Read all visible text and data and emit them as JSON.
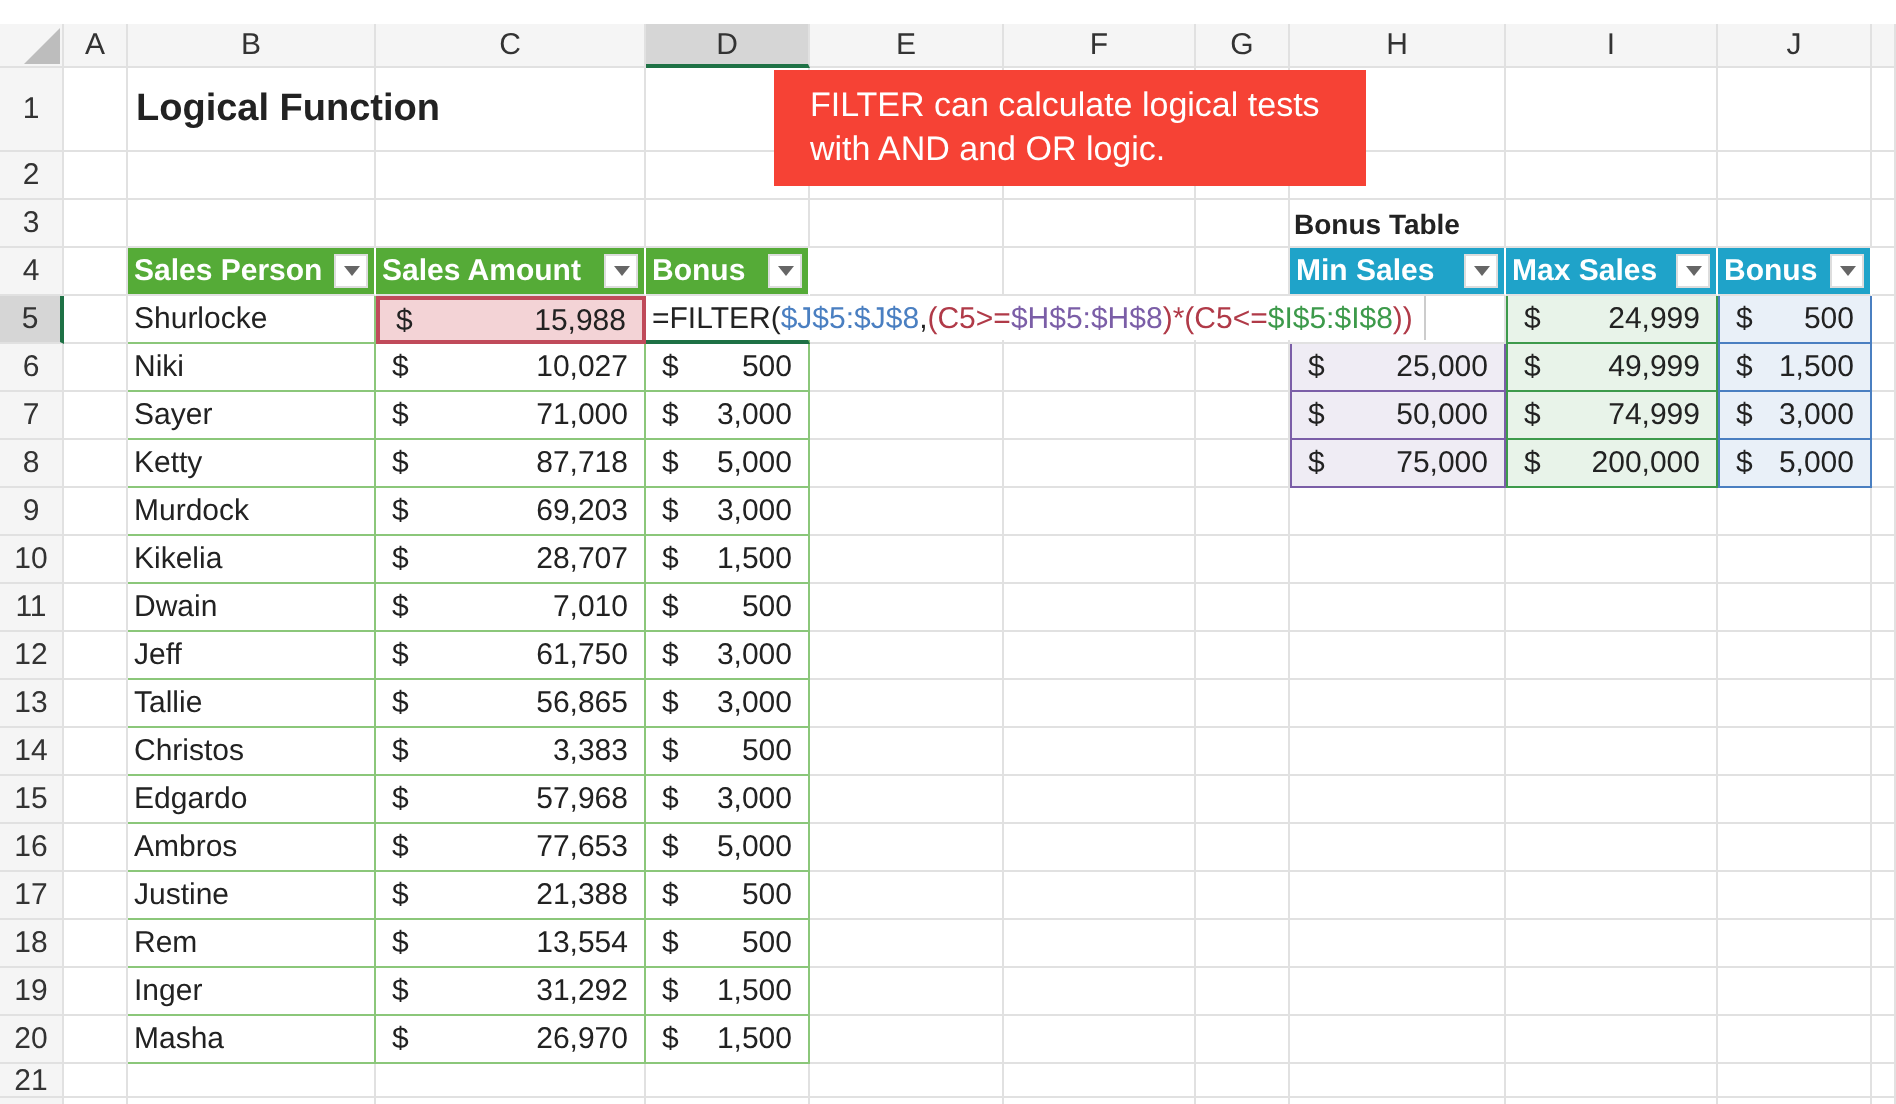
{
  "column_headers": [
    {
      "label": "A",
      "selected": false
    },
    {
      "label": "B",
      "selected": false
    },
    {
      "label": "C",
      "selected": false
    },
    {
      "label": "D",
      "selected": true
    },
    {
      "label": "E",
      "selected": false
    },
    {
      "label": "F",
      "selected": false
    },
    {
      "label": "G",
      "selected": false
    },
    {
      "label": "H",
      "selected": false
    },
    {
      "label": "I",
      "selected": false
    },
    {
      "label": "J",
      "selected": false
    }
  ],
  "row_headers": [
    {
      "label": "1",
      "selected": false
    },
    {
      "label": "2",
      "selected": false
    },
    {
      "label": "3",
      "selected": false
    },
    {
      "label": "4",
      "selected": false
    },
    {
      "label": "5",
      "selected": true
    },
    {
      "label": "6",
      "selected": false
    },
    {
      "label": "7",
      "selected": false
    },
    {
      "label": "8",
      "selected": false
    },
    {
      "label": "9",
      "selected": false
    },
    {
      "label": "10",
      "selected": false
    },
    {
      "label": "11",
      "selected": false
    },
    {
      "label": "12",
      "selected": false
    },
    {
      "label": "13",
      "selected": false
    },
    {
      "label": "14",
      "selected": false
    },
    {
      "label": "15",
      "selected": false
    },
    {
      "label": "16",
      "selected": false
    },
    {
      "label": "17",
      "selected": false
    },
    {
      "label": "18",
      "selected": false
    },
    {
      "label": "19",
      "selected": false
    },
    {
      "label": "20",
      "selected": false
    },
    {
      "label": "21",
      "selected": false
    }
  ],
  "title": "Logical Function",
  "callout": "FILTER can calculate logical tests with AND and OR logic.",
  "sales_table": {
    "columns": [
      "Sales Person",
      "Sales Amount",
      "Bonus"
    ],
    "rows": [
      {
        "person": "Shurlocke",
        "currency": "$",
        "amount": "15,988",
        "referenced": true,
        "formula": [
          {
            "text": "=FILTER(",
            "color": "#222222"
          },
          {
            "text": "$J$5:$J$8",
            "color": "#4a7fc1"
          },
          {
            "text": ",",
            "color": "#222222"
          },
          {
            "text": "(C5>=",
            "color": "#b03a48"
          },
          {
            "text": "$H$5:$H$8",
            "color": "#7b5ea7"
          },
          {
            "text": ")*(C5<=",
            "color": "#b03a48"
          },
          {
            "text": "$I$5:$I$8",
            "color": "#3d9a4b"
          },
          {
            "text": "))",
            "color": "#b03a48"
          }
        ]
      },
      {
        "person": "Niki",
        "currency": "$",
        "amount": "10,027",
        "referenced": false,
        "bonus_currency": "$",
        "bonus": "500"
      },
      {
        "person": "Sayer",
        "currency": "$",
        "amount": "71,000",
        "referenced": false,
        "bonus_currency": "$",
        "bonus": "3,000"
      },
      {
        "person": "Ketty",
        "currency": "$",
        "amount": "87,718",
        "referenced": false,
        "bonus_currency": "$",
        "bonus": "5,000"
      },
      {
        "person": "Murdock",
        "currency": "$",
        "amount": "69,203",
        "referenced": false,
        "bonus_currency": "$",
        "bonus": "3,000"
      },
      {
        "person": "Kikelia",
        "currency": "$",
        "amount": "28,707",
        "referenced": false,
        "bonus_currency": "$",
        "bonus": "1,500"
      },
      {
        "person": "Dwain",
        "currency": "$",
        "amount": "7,010",
        "referenced": false,
        "bonus_currency": "$",
        "bonus": "500"
      },
      {
        "person": "Jeff",
        "currency": "$",
        "amount": "61,750",
        "referenced": false,
        "bonus_currency": "$",
        "bonus": "3,000"
      },
      {
        "person": "Tallie",
        "currency": "$",
        "amount": "56,865",
        "referenced": false,
        "bonus_currency": "$",
        "bonus": "3,000"
      },
      {
        "person": "Christos",
        "currency": "$",
        "amount": "3,383",
        "referenced": false,
        "bonus_currency": "$",
        "bonus": "500"
      },
      {
        "person": "Edgardo",
        "currency": "$",
        "amount": "57,968",
        "referenced": false,
        "bonus_currency": "$",
        "bonus": "3,000"
      },
      {
        "person": "Ambros",
        "currency": "$",
        "amount": "77,653",
        "referenced": false,
        "bonus_currency": "$",
        "bonus": "5,000"
      },
      {
        "person": "Justine",
        "currency": "$",
        "amount": "21,388",
        "referenced": false,
        "bonus_currency": "$",
        "bonus": "500"
      },
      {
        "person": "Rem",
        "currency": "$",
        "amount": "13,554",
        "referenced": false,
        "bonus_currency": "$",
        "bonus": "500"
      },
      {
        "person": "Inger",
        "currency": "$",
        "amount": "31,292",
        "referenced": false,
        "bonus_currency": "$",
        "bonus": "1,500"
      },
      {
        "person": "Masha",
        "currency": "$",
        "amount": "26,970",
        "referenced": false,
        "bonus_currency": "$",
        "bonus": "1,500"
      }
    ]
  },
  "bonus_table": {
    "title": "Bonus Table",
    "columns": [
      {
        "label": "Min Sales",
        "color": "#7b5ea7"
      },
      {
        "label": "Max Sales",
        "color": "#3d9a4b"
      },
      {
        "label": "Bonus",
        "color": "#4a7fc1"
      }
    ],
    "rows": [
      [
        null,
        {
          "currency": "$",
          "value": "24,999"
        },
        {
          "currency": "$",
          "value": "500"
        }
      ],
      [
        {
          "currency": "$",
          "value": "25,000"
        },
        {
          "currency": "$",
          "value": "49,999"
        },
        {
          "currency": "$",
          "value": "1,500"
        }
      ],
      [
        {
          "currency": "$",
          "value": "50,000"
        },
        {
          "currency": "$",
          "value": "74,999"
        },
        {
          "currency": "$",
          "value": "3,000"
        }
      ],
      [
        {
          "currency": "$",
          "value": "75,000"
        },
        {
          "currency": "$",
          "value": "200,000"
        },
        {
          "currency": "$",
          "value": "5,000"
        }
      ]
    ]
  }
}
